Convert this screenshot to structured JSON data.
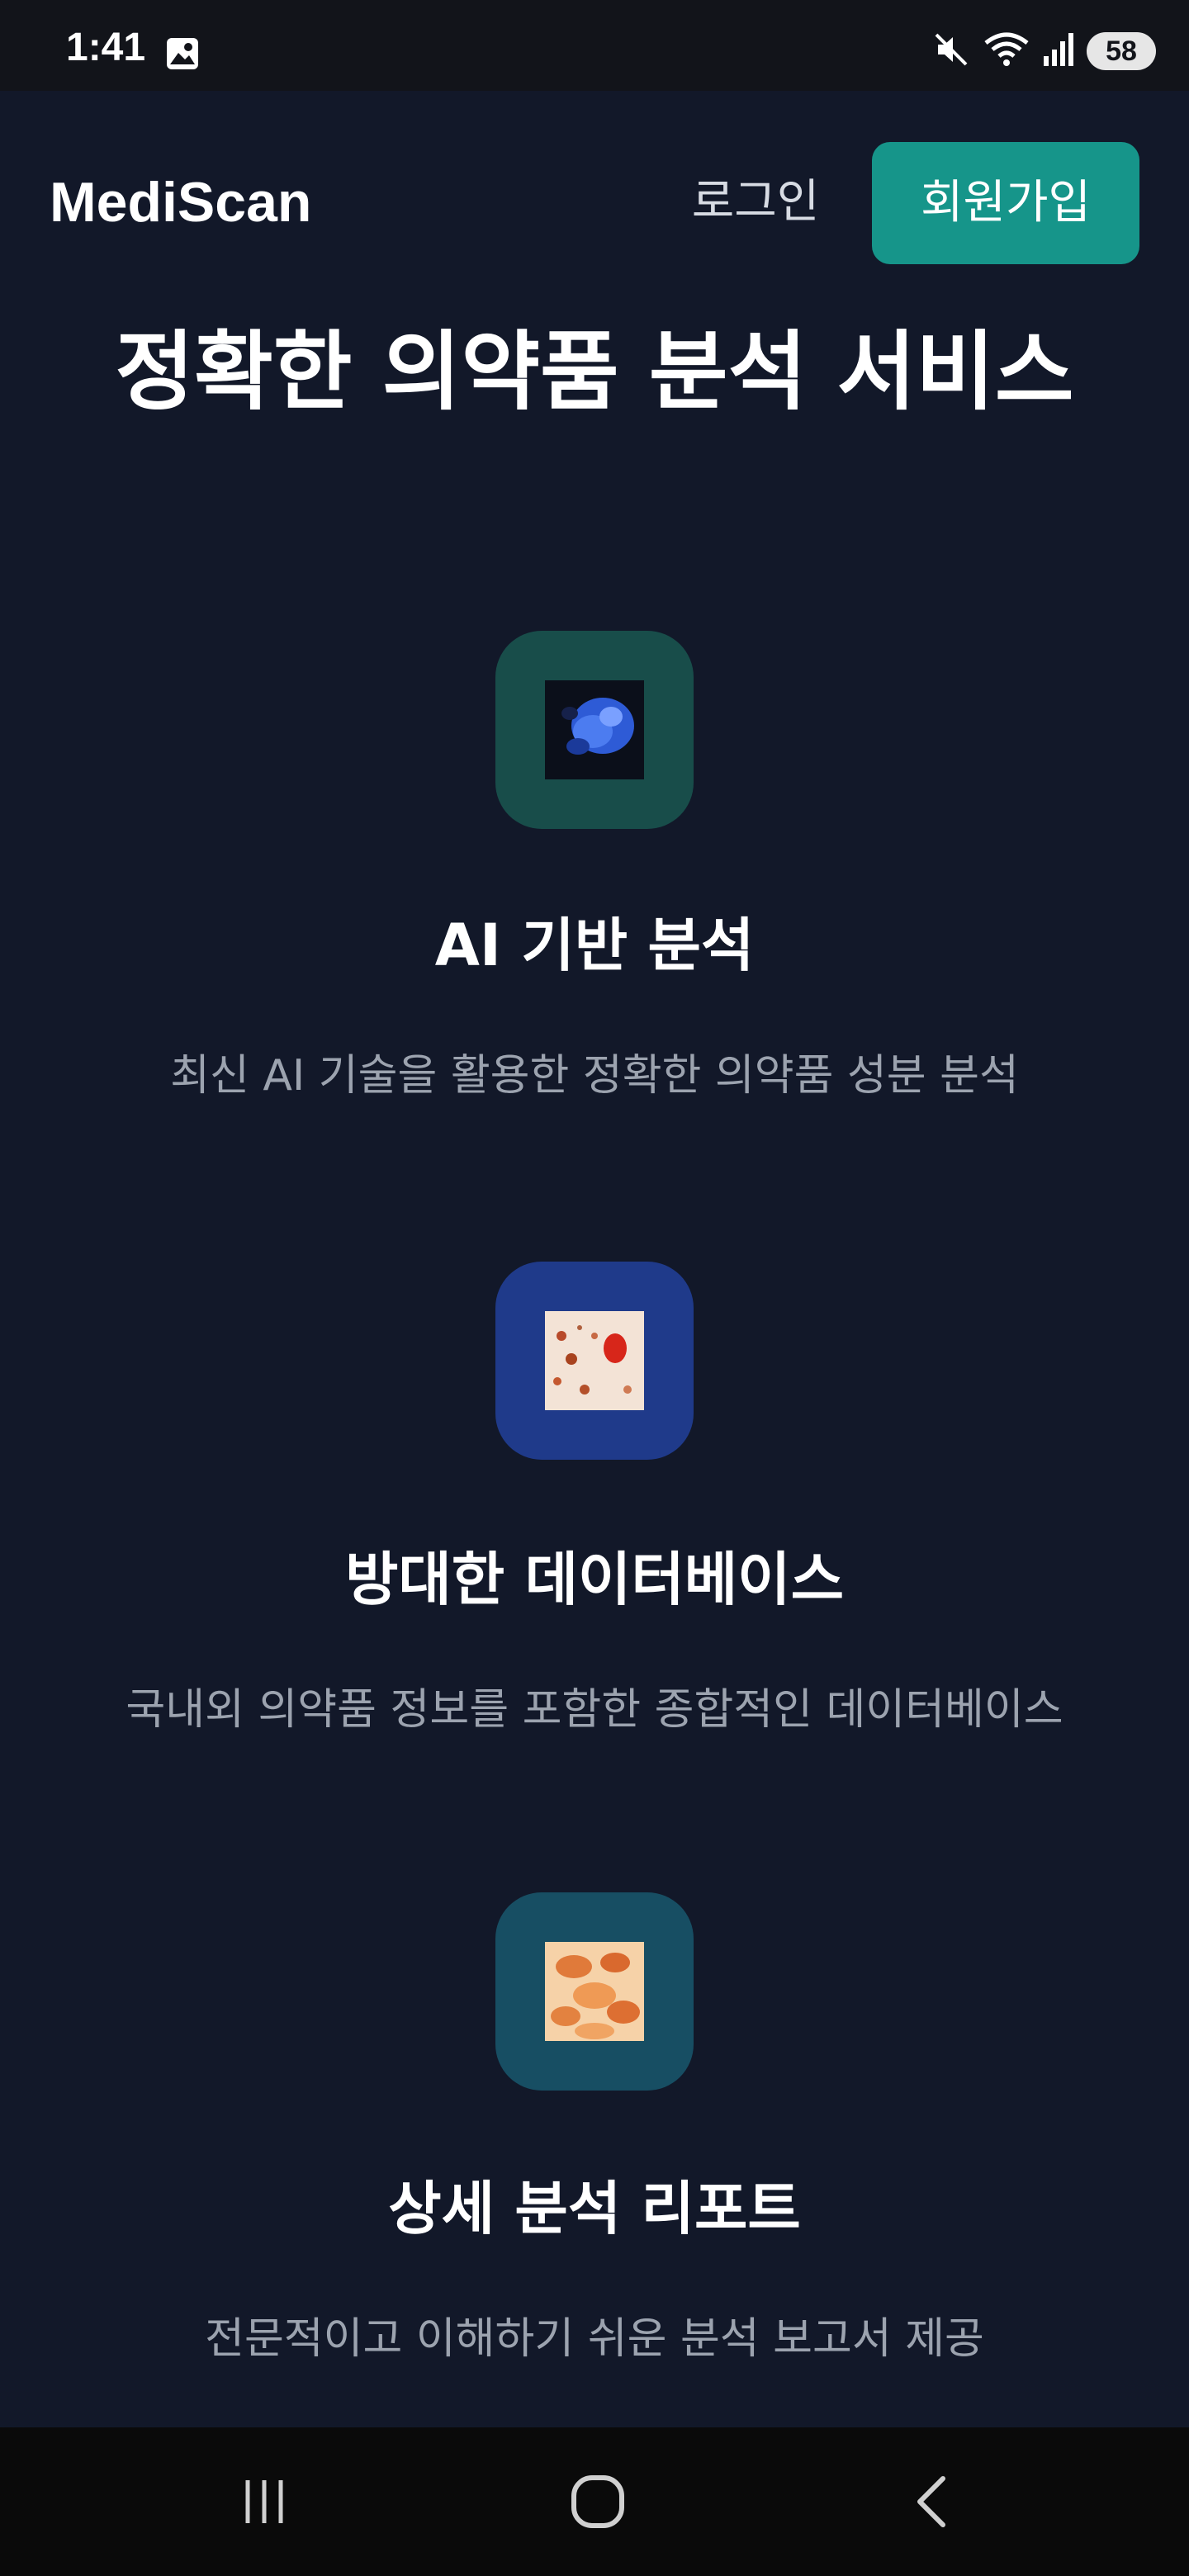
{
  "status_bar": {
    "time": "1:41",
    "battery": "58",
    "icons": [
      "image-icon",
      "mute-icon",
      "wifi-icon",
      "signal-icon",
      "battery-icon"
    ]
  },
  "header": {
    "logo": "MediScan",
    "login": "로그인",
    "signup": "회원가입"
  },
  "hero": {
    "title": "정확한 의약품 분석 서비스"
  },
  "features": [
    {
      "title": "AI 기반 분석",
      "description": "최신 AI 기술을 활용한 정확한 의약품 성분 분석",
      "icon_bg": "#184d4a"
    },
    {
      "title": "방대한 데이터베이스",
      "description": "국내외 의약품 정보를 포함한 종합적인 데이터베이스",
      "icon_bg": "#1f3a8a"
    },
    {
      "title": "상세 분석 리포트",
      "description": "전문적이고 이해하기 쉬운 분석 보고서 제공",
      "icon_bg": "#174e63"
    }
  ],
  "colors": {
    "background": "#121829",
    "accent": "#16958a",
    "muted_text": "#9ca3af"
  },
  "nav": {
    "buttons": [
      "recent-apps-icon",
      "home-icon",
      "back-icon"
    ]
  }
}
